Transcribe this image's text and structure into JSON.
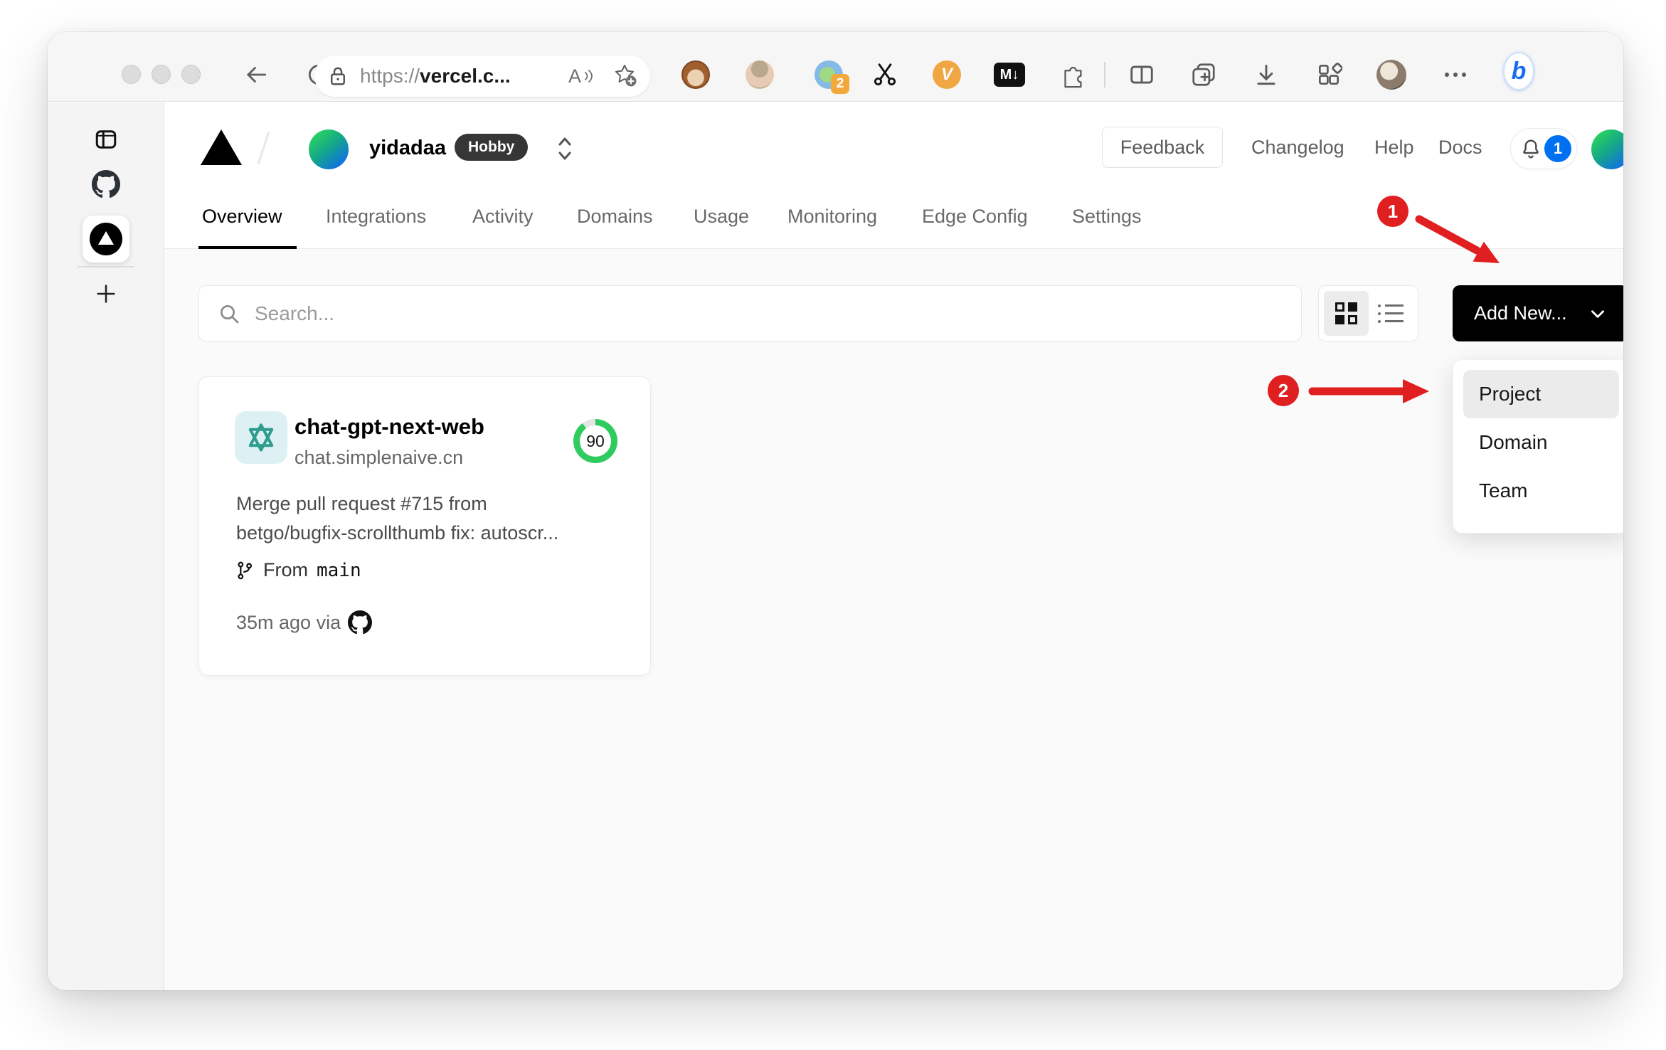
{
  "browser": {
    "url_scheme": "https://",
    "url_host": "vercel.c...",
    "read_aloud_label": "A",
    "extension_badge": "2",
    "markdown_label": "M↓",
    "v_extension_label": "V",
    "bing_label": "b"
  },
  "header": {
    "team": "yidadaa",
    "plan": "Hobby",
    "feedback": "Feedback",
    "links": [
      "Changelog",
      "Help",
      "Docs"
    ],
    "notification_count": "1"
  },
  "tabs": [
    {
      "label": "Overview",
      "active": true
    },
    {
      "label": "Integrations",
      "active": false
    },
    {
      "label": "Activity",
      "active": false
    },
    {
      "label": "Domains",
      "active": false
    },
    {
      "label": "Usage",
      "active": false
    },
    {
      "label": "Monitoring",
      "active": false
    },
    {
      "label": "Edge Config",
      "active": false
    },
    {
      "label": "Settings",
      "active": false
    }
  ],
  "toolbar": {
    "search_placeholder": "Search...",
    "add_new": "Add New..."
  },
  "dropdown": {
    "items": [
      {
        "label": "Project",
        "highlighted": true
      },
      {
        "label": "Domain",
        "highlighted": false
      },
      {
        "label": "Team",
        "highlighted": false
      }
    ]
  },
  "project": {
    "name": "chat-gpt-next-web",
    "domain": "chat.simplenaive.cn",
    "score": "90",
    "commit_line1": "Merge pull request #715 from",
    "commit_line2": "betgo/bugfix-scrollthumb fix: autoscr...",
    "from_label": "From",
    "branch": "main",
    "meta": "35m ago via"
  },
  "annotations": {
    "step1": "1",
    "step2": "2"
  },
  "colors": {
    "annotation_red": "#E02020",
    "score_green": "#2FCB5F",
    "notification_blue": "#0070F3",
    "add_new_black": "#000000",
    "content_bg": "#fafafa"
  }
}
